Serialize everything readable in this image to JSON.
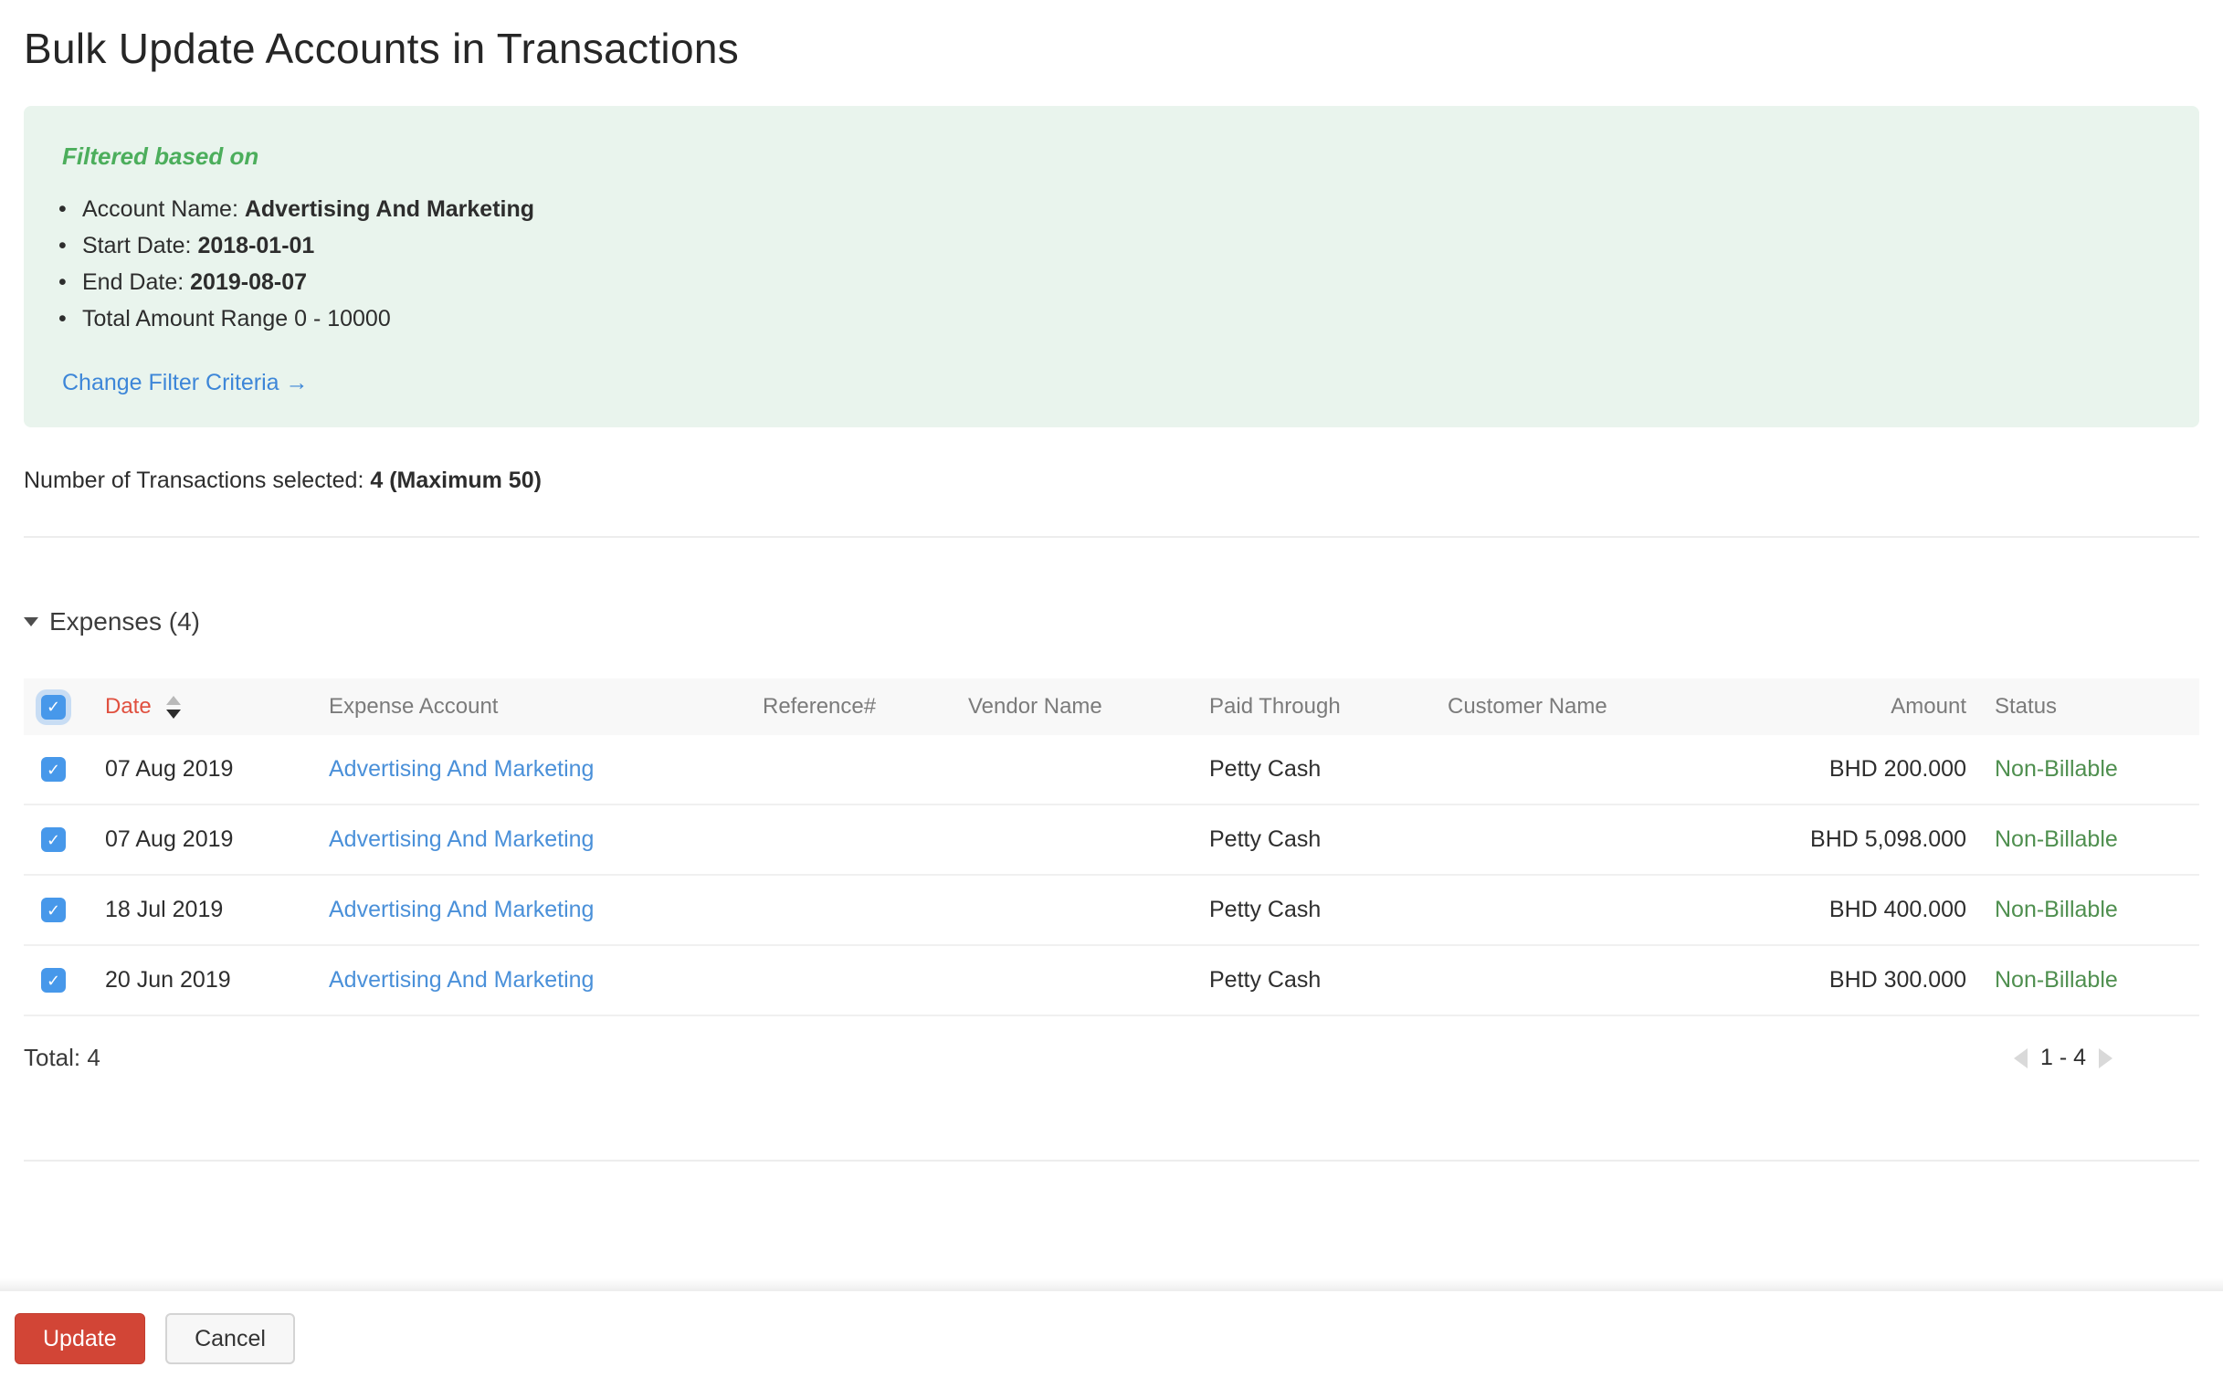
{
  "page": {
    "title": "Bulk Update Accounts in Transactions"
  },
  "filter": {
    "heading": "Filtered based on",
    "criteria": [
      {
        "label": "Account Name: ",
        "value": "Advertising And Marketing"
      },
      {
        "label": "Start Date: ",
        "value": "2018-01-01"
      },
      {
        "label": "End Date: ",
        "value": "2019-08-07"
      },
      {
        "label": "Total Amount Range 0 - 10000",
        "value": ""
      }
    ],
    "change_link": "Change Filter Criteria →"
  },
  "selection": {
    "label": "Number of Transactions selected: ",
    "value": "4 (Maximum 50)"
  },
  "section": {
    "title": "Expenses (4)"
  },
  "table": {
    "headers": {
      "date": "Date",
      "expense_account": "Expense Account",
      "reference": "Reference#",
      "vendor": "Vendor Name",
      "paid_through": "Paid Through",
      "customer": "Customer Name",
      "amount": "Amount",
      "status": "Status"
    },
    "rows": [
      {
        "date": "07 Aug 2019",
        "expense_account": "Advertising And Marketing",
        "reference": "",
        "vendor": "",
        "paid_through": "Petty Cash",
        "customer": "",
        "amount": "BHD 200.000",
        "status": "Non-Billable"
      },
      {
        "date": "07 Aug 2019",
        "expense_account": "Advertising And Marketing",
        "reference": "",
        "vendor": "",
        "paid_through": "Petty Cash",
        "customer": "",
        "amount": "BHD 5,098.000",
        "status": "Non-Billable"
      },
      {
        "date": "18 Jul 2019",
        "expense_account": "Advertising And Marketing",
        "reference": "",
        "vendor": "",
        "paid_through": "Petty Cash",
        "customer": "",
        "amount": "BHD 400.000",
        "status": "Non-Billable"
      },
      {
        "date": "20 Jun 2019",
        "expense_account": "Advertising And Marketing",
        "reference": "",
        "vendor": "",
        "paid_through": "Petty Cash",
        "customer": "",
        "amount": "BHD 300.000",
        "status": "Non-Billable"
      }
    ],
    "total": "Total: 4",
    "pagination": {
      "range": "1 - 4"
    }
  },
  "footer": {
    "update": "Update",
    "cancel": "Cancel"
  },
  "colors": {
    "filter_bg": "#e9f4ed",
    "filter_heading_green": "#4cae5c",
    "link_blue": "#3d86d8",
    "row_link_blue": "#4a90d9",
    "date_header_red": "#e0503f",
    "status_green": "#4f8f4f",
    "checkbox_blue": "#4798ea",
    "update_button_red": "#d24536"
  }
}
